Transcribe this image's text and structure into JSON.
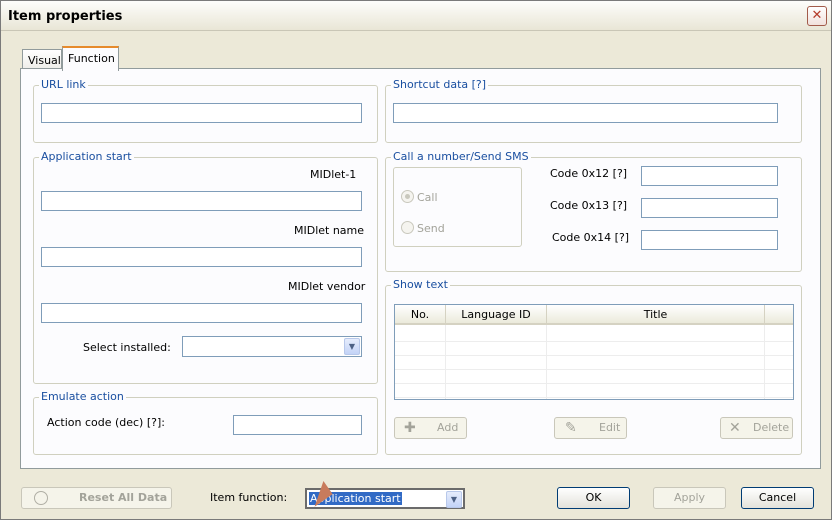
{
  "window": {
    "title": "Item properties",
    "close_icon": "close-icon"
  },
  "tabs": [
    {
      "label": "Visual"
    },
    {
      "label": "Function"
    }
  ],
  "url_link": {
    "legend": "URL link",
    "value": ""
  },
  "shortcut": {
    "legend": "Shortcut data [?]",
    "value": ""
  },
  "app_start": {
    "legend": "Application start",
    "midlet1_label": "MIDlet-1",
    "midlet1_value": "",
    "midlet_name_label": "MIDlet name",
    "midlet_name_value": "",
    "midlet_vendor_label": "MIDlet vendor",
    "midlet_vendor_value": "",
    "select_installed_label": "Select installed:",
    "select_installed_value": ""
  },
  "call_sms": {
    "legend": "Call a number/Send SMS",
    "call_label": "Call",
    "send_label": "Send",
    "code12_label": "Code 0x12 [?]",
    "code13_label": "Code 0x13 [?]",
    "code14_label": "Code 0x14 [?]"
  },
  "show_text": {
    "legend": "Show text",
    "columns": [
      "No.",
      "Language ID",
      "Title"
    ],
    "add_label": "Add",
    "edit_label": "Edit",
    "delete_label": "Delete"
  },
  "emulate": {
    "legend": "Emulate action",
    "action_code_label": "Action code (dec) [?]:",
    "action_code_value": ""
  },
  "footer": {
    "reset_label": "Reset All Data",
    "item_function_label": "Item function:",
    "item_function_value": "Application start",
    "ok_label": "OK",
    "apply_label": "Apply",
    "cancel_label": "Cancel"
  }
}
